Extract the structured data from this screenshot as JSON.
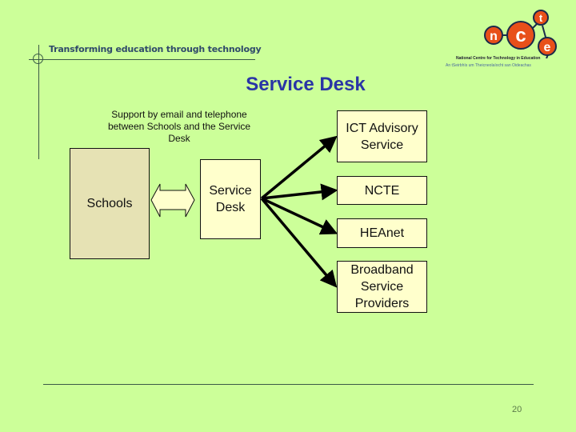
{
  "header": {
    "tagline": "Transforming education through technology",
    "logo": {
      "letters": [
        "n",
        "c",
        "t",
        "e"
      ],
      "subtitle_en": "National Centre for Technology in Education",
      "subtitle_ga": "An tSeirbhís um Theicneolaíocht san Oideachas",
      "accent_color": "#e8501a"
    }
  },
  "slide": {
    "title": "Service Desk",
    "caption": "Support by email and telephone between Schools and the Service Desk",
    "page_number": "20"
  },
  "diagram": {
    "schools": "Schools",
    "service_desk": "Service Desk",
    "targets": [
      {
        "id": "ict",
        "label": "ICT Advisory Service"
      },
      {
        "id": "ncte",
        "label": "NCTE"
      },
      {
        "id": "heanet",
        "label": "HEAnet"
      },
      {
        "id": "broadband",
        "label": "Broadband Service Providers"
      }
    ],
    "links": [
      {
        "from": "Schools",
        "to": "Service Desk",
        "type": "bidirectional"
      },
      {
        "from": "Service Desk",
        "to": "ICT Advisory Service",
        "type": "arrow"
      },
      {
        "from": "Service Desk",
        "to": "NCTE",
        "type": "arrow"
      },
      {
        "from": "Service Desk",
        "to": "HEAnet",
        "type": "arrow"
      },
      {
        "from": "Service Desk",
        "to": "Broadband Service Providers",
        "type": "arrow"
      }
    ]
  }
}
